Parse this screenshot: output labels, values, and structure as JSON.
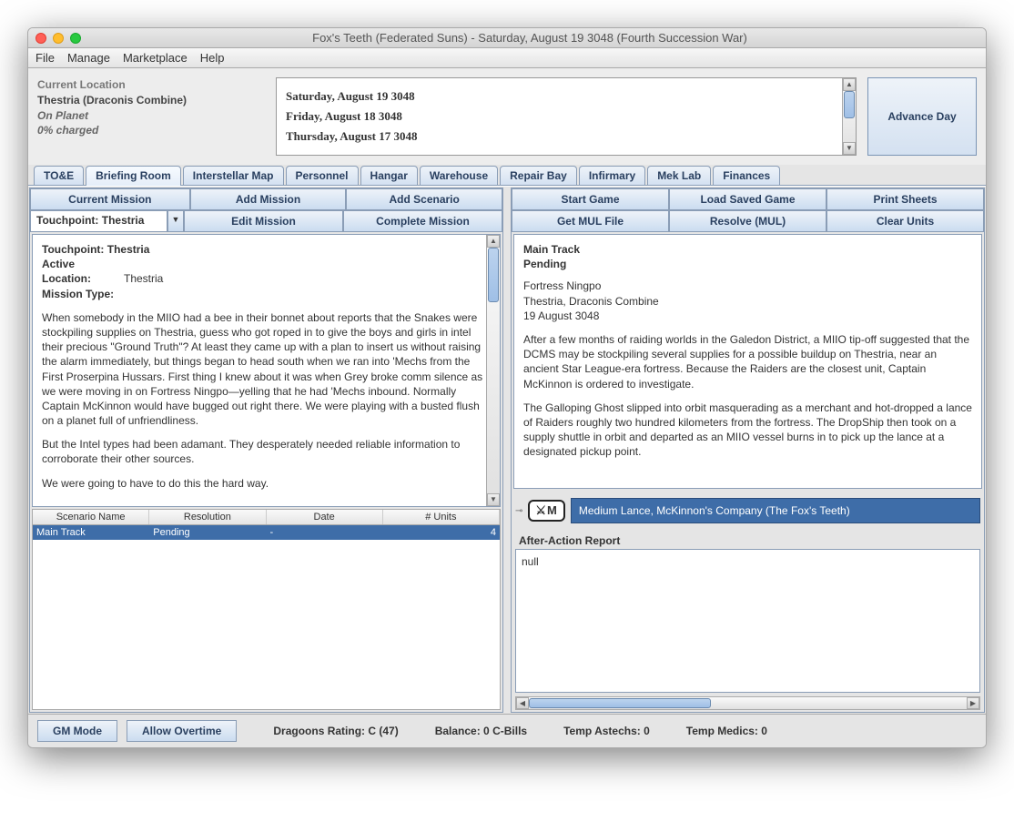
{
  "window": {
    "title": "Fox's Teeth (Federated Suns) - Saturday, August 19 3048 (Fourth Succession War)"
  },
  "menu": {
    "file": "File",
    "manage": "Manage",
    "marketplace": "Marketplace",
    "help": "Help"
  },
  "location": {
    "label": "Current Location",
    "value": "Thestria (Draconis Combine)",
    "status": "On Planet",
    "charge": "0% charged"
  },
  "days": {
    "d0": "Saturday, August 19 3048",
    "d1": "Friday, August 18 3048",
    "d2": "Thursday, August 17 3048"
  },
  "advance": "Advance Day",
  "tabs": {
    "toe": "TO&E",
    "briefing": "Briefing Room",
    "map": "Interstellar Map",
    "personnel": "Personnel",
    "hangar": "Hangar",
    "warehouse": "Warehouse",
    "repair": "Repair Bay",
    "infirmary": "Infirmary",
    "meklab": "Mek Lab",
    "finances": "Finances"
  },
  "left": {
    "current_mission": "Current Mission",
    "add_mission": "Add Mission",
    "add_scenario": "Add Scenario",
    "edit_mission": "Edit Mission",
    "complete_mission": "Complete Mission",
    "mission_selected": "Touchpoint: Thestria",
    "pane": {
      "title": "Touchpoint: Thestria",
      "status": "Active",
      "loc_label": "Location:",
      "loc_value": "Thestria",
      "type_label": "Mission Type:",
      "para1": "When somebody in the MIIO had a bee in their bonnet about reports that the Snakes were stockpiling supplies on Thestria, guess who got roped in to give the boys and girls in intel their precious \"Ground Truth\"? At least they came up with a plan to insert us without raising the alarm immediately, but things began to head south when we ran into 'Mechs from the First Proserpina Hussars. First thing I knew about it was when Grey broke comm silence as we were moving in on Fortress Ningpo—yelling that he had 'Mechs inbound. Normally Captain McKinnon would have bugged out right there. We were playing with a busted flush on a planet full of unfriendliness.",
      "para2": "But the Intel types had been adamant. They desperately needed reliable information to corroborate their other sources.",
      "para3": "We were going to have to do this the hard way."
    },
    "table": {
      "h0": "Scenario Name",
      "h1": "Resolution",
      "h2": "Date",
      "h3": "# Units",
      "r0c0": "Main Track",
      "r0c1": "Pending",
      "r0c2": "-",
      "r0c3": "4"
    }
  },
  "right": {
    "start_game": "Start Game",
    "load_game": "Load Saved Game",
    "print": "Print Sheets",
    "get_mul": "Get MUL File",
    "resolve": "Resolve (MUL)",
    "clear": "Clear Units",
    "pane": {
      "title": "Main Track",
      "status": "Pending",
      "l1": "Fortress Ningpo",
      "l2": "Thestria, Draconis Combine",
      "l3": "19 August 3048",
      "para1": "After a few months of raiding worlds in the Galedon District, a MIIO tip-off suggested that the DCMS may be stockpiling several supplies for a possible buildup on Thestria, near an ancient Star League-era fortress. Because the Raiders are the closest unit, Captain McKinnon is ordered to investigate.",
      "para2": "The Galloping Ghost slipped into orbit masquerading as a merchant and hot-dropped a lance of Raiders roughly two hundred kilometers from the fortress. The DropShip then took on a supply shuttle in orbit and departed as an MIIO vessel burns in to pick up the lance at a designated pickup point."
    },
    "unit": {
      "badge": "⚔M",
      "label": "Medium Lance, McKinnon's Company (The Fox's Teeth)"
    },
    "aar_label": "After-Action Report",
    "aar_value": "null"
  },
  "footer": {
    "gm": "GM Mode",
    "overtime": "Allow Overtime",
    "dragoons": "Dragoons Rating: C (47)",
    "balance": "Balance: 0 C-Bills",
    "astechs": "Temp Astechs: 0",
    "medics": "Temp Medics: 0"
  }
}
